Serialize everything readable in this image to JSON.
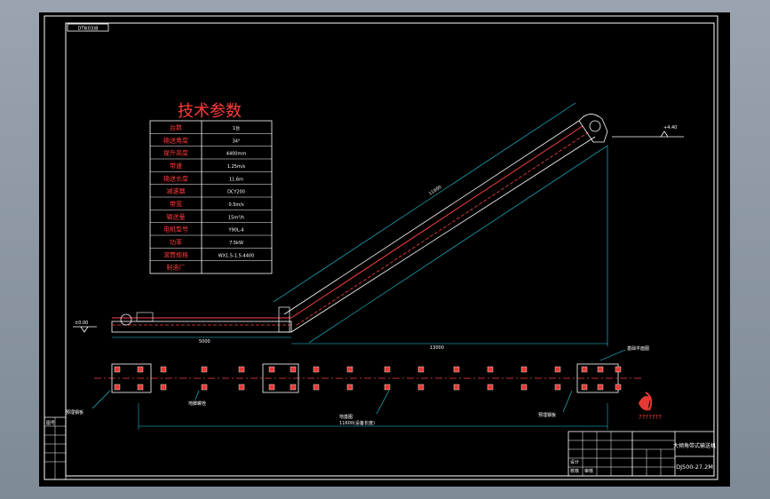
{
  "header": {
    "code_box": "DTⅡ(03)B"
  },
  "params": {
    "title": "技术参数",
    "rows": [
      {
        "label": "台数",
        "value": "1台"
      },
      {
        "label": "输送角度",
        "value": "34°"
      },
      {
        "label": "提升高度",
        "value": "4400mm"
      },
      {
        "label": "带速",
        "value": "1.25m/s"
      },
      {
        "label": "输送长度",
        "value": "11.6m"
      },
      {
        "label": "减速器",
        "value": "DCY200"
      },
      {
        "label": "带宽",
        "value": "0.5m/s"
      },
      {
        "label": "输送量",
        "value": "15m³/h"
      },
      {
        "label": "电机型号",
        "value": "Y90L-4"
      },
      {
        "label": "功率",
        "value": "7.5kW"
      },
      {
        "label": "滚筒规格",
        "value": "WX1.5-1.5-4400"
      },
      {
        "label": "制造厂",
        "value": ""
      }
    ]
  },
  "annotations": {
    "ground_left": "±0.00",
    "ground_right": "+4.40",
    "dim_incline": "11600",
    "dim_horizontal": "5000",
    "dim_total": "13000",
    "dim_plan": "11600(设备长度)",
    "leader_1": "预埋钢板",
    "leader_2": "地脚螺栓",
    "leader_3": "地基图",
    "leader_4": "预埋钢板",
    "leader_5": "基础平面图"
  },
  "logo_text": "???????",
  "title_block": {
    "drawing_title": "大倾角带式输送机",
    "drawing_number": "DJ500-27.2M",
    "row_labels": [
      "设计",
      "校核",
      "审核"
    ]
  },
  "revision_block": {
    "label": "图号"
  }
}
